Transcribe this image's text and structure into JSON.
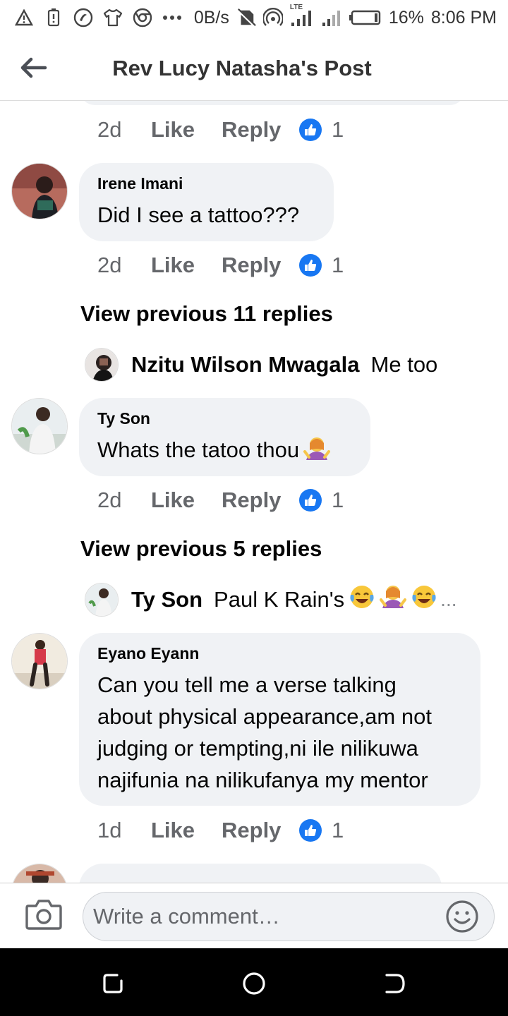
{
  "status_bar": {
    "net_speed": "0B/s",
    "network_label": "LTE",
    "battery": "16%",
    "time": "8:06 PM"
  },
  "header": {
    "title": "Rev Lucy Natasha's Post"
  },
  "comments": [
    {
      "time": "2d",
      "like_label": "Like",
      "reply_label": "Reply",
      "reactions": "1"
    },
    {
      "author": "Irene Imani",
      "text": "Did I see a tattoo???",
      "time": "2d",
      "like_label": "Like",
      "reply_label": "Reply",
      "reactions": "1",
      "view_previous": "View previous 11 replies",
      "latest_reply": {
        "author": "Nzitu Wilson Mwagala",
        "text": "Me too"
      }
    },
    {
      "author": "Ty Son",
      "text": "Whats the tatoo thou",
      "time": "2d",
      "like_label": "Like",
      "reply_label": "Reply",
      "reactions": "1",
      "view_previous": "View previous 5 replies",
      "latest_reply": {
        "author": "Ty Son",
        "text": "Paul K Rain's",
        "ellipsis": "..."
      }
    },
    {
      "author": "Eyano Eyann",
      "text_lines": [
        "Can you tell me a verse talking",
        "about physical appearance,am not",
        "judging or tempting,ni ile nilikuwa",
        "najifunia na nilikufanya my mentor"
      ],
      "time": "1d",
      "like_label": "Like",
      "reply_label": "Reply",
      "reactions": "1"
    }
  ],
  "composer": {
    "placeholder": "Write a comment…"
  },
  "colors": {
    "accent": "#1877f2",
    "bubble": "#f0f2f5",
    "meta": "#65676b"
  }
}
